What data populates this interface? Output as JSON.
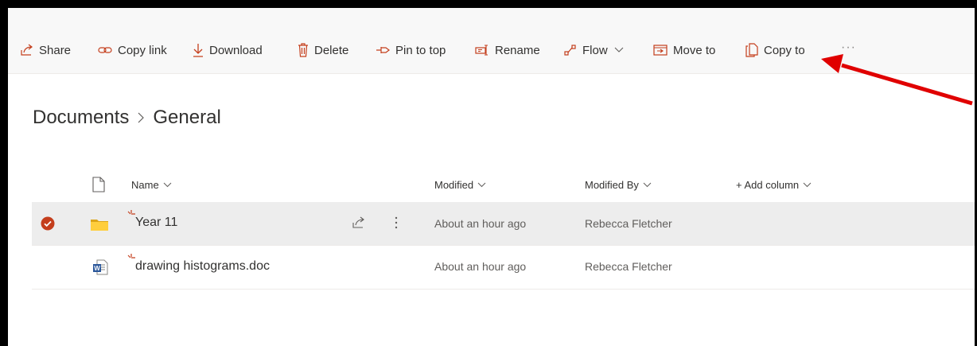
{
  "toolbar": {
    "share": "Share",
    "copy_link": "Copy link",
    "download": "Download",
    "delete": "Delete",
    "pin_to_top": "Pin to top",
    "rename": "Rename",
    "flow": "Flow",
    "move_to": "Move to",
    "copy_to": "Copy to",
    "more": "···"
  },
  "breadcrumb": [
    "Documents",
    "General"
  ],
  "columns": {
    "name": "Name",
    "modified": "Modified",
    "modified_by": "Modified By",
    "add_column": "+ Add column"
  },
  "files": [
    {
      "name": "Year 11",
      "type": "folder",
      "modified": "About an hour ago",
      "modified_by": "Rebecca Fletcher",
      "selected": true
    },
    {
      "name": "drawing histograms.doc",
      "type": "word",
      "modified": "About an hour ago",
      "modified_by": "Rebecca Fletcher",
      "selected": false
    }
  ],
  "colors": {
    "accent": "#c43e1c",
    "folder": "#ffce3d",
    "word": "#2b579a",
    "annotation_arrow": "#e00000",
    "selected_row": "#ededed"
  },
  "icons": [
    "share-icon",
    "link-icon",
    "download-icon",
    "delete-icon",
    "pin-icon",
    "rename-icon",
    "flow-icon",
    "move-icon",
    "copy-icon",
    "more-icon",
    "file-icon",
    "folder-icon",
    "word-icon",
    "checkmark-icon",
    "new-item-sparkle-icon"
  ]
}
